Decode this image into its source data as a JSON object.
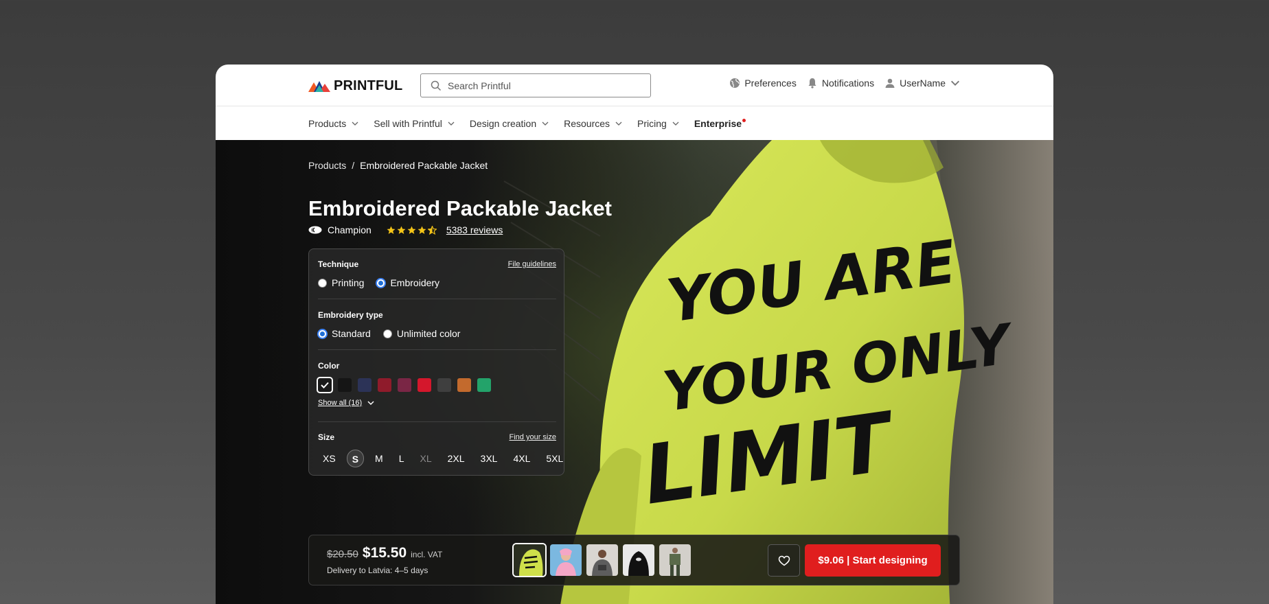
{
  "header": {
    "logo_text": "PRINTFUL",
    "search_placeholder": "Search Printful",
    "preferences": "Preferences",
    "notifications": "Notifications",
    "username": "UserName"
  },
  "nav": {
    "items": [
      {
        "label": "Products"
      },
      {
        "label": "Sell with Printful"
      },
      {
        "label": "Design creation"
      },
      {
        "label": "Resources"
      },
      {
        "label": "Pricing"
      }
    ],
    "enterprise": "Enterprise"
  },
  "breadcrumb": {
    "root": "Products",
    "separator": "/",
    "current": "Embroidered Packable Jacket"
  },
  "product": {
    "title": "Embroidered Packable Jacket",
    "brand": "Champion",
    "rating": 4.5,
    "reviews": "5383 reviews",
    "hero_text": [
      "YOU ARE",
      "YOUR ONLY",
      "LIMIT"
    ]
  },
  "options": {
    "technique": {
      "label": "Technique",
      "link": "File guidelines",
      "choices": [
        "Printing",
        "Embroidery"
      ],
      "selected": "Embroidery"
    },
    "embroidery_type": {
      "label": "Embroidery type",
      "choices": [
        "Standard",
        "Unlimited color"
      ],
      "selected": "Standard"
    },
    "color": {
      "label": "Color",
      "swatches": [
        "#ffffff",
        "#151515",
        "#2c3357",
        "#8f1b2b",
        "#7a2645",
        "#d4172c",
        "#3f3f3f",
        "#c36a2d",
        "#23a36a"
      ],
      "selected_index": 0,
      "show_all": "Show all (16)"
    },
    "size": {
      "label": "Size",
      "link": "Find your size",
      "choices": [
        "XS",
        "S",
        "M",
        "L",
        "XL",
        "2XL",
        "3XL",
        "4XL",
        "5XL"
      ],
      "selected": "S",
      "unavailable": [
        "XL"
      ]
    }
  },
  "buybar": {
    "old_price": "$20.50",
    "price": "$15.50",
    "vat": "incl. VAT",
    "delivery": "Delivery to Latvia: 4–5 days",
    "cta": "$9.06 | Start designing",
    "thumbnail_count": 5
  },
  "colors": {
    "accent": "#e01e1e",
    "jacket": "#cfe04a",
    "radio_selected": "#1f6fd6"
  }
}
